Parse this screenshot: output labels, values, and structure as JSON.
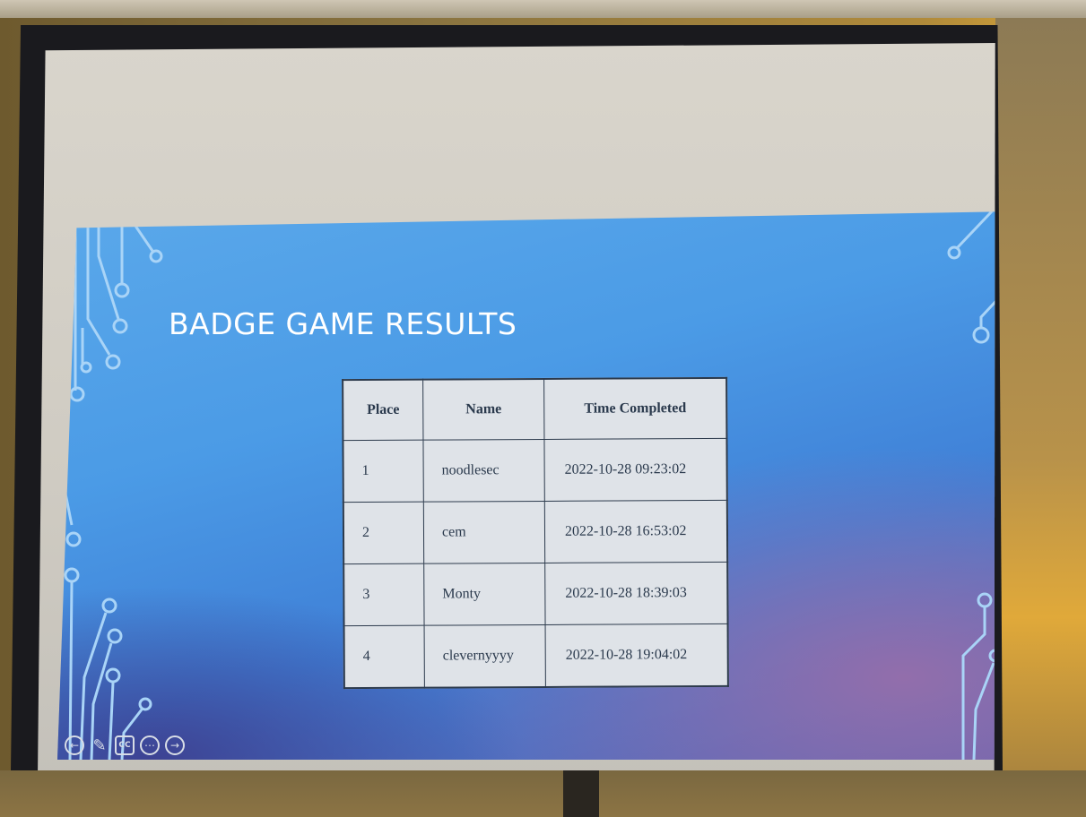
{
  "slide": {
    "title": "BADGE GAME RESULTS"
  },
  "table": {
    "headers": [
      "Place",
      "Name",
      "Time Completed"
    ],
    "rows": [
      {
        "place": "1",
        "name": "noodlesec",
        "time": "2022-10-28 09:23:02"
      },
      {
        "place": "2",
        "name": "cem",
        "time": "2022-10-28 16:53:02"
      },
      {
        "place": "3",
        "name": "Monty",
        "time": "2022-10-28 18:39:03"
      },
      {
        "place": "4",
        "name": "clevernyyyy",
        "time": "2022-10-28 19:04:02"
      }
    ]
  },
  "controls": {
    "icons": [
      "previous-icon",
      "pen-icon",
      "captions-icon",
      "more-icon",
      "next-icon"
    ],
    "captions_label": "CC"
  },
  "colors": {
    "slide_gradient_top": "#5aa8ea",
    "slide_gradient_bottom": "#5c62b0",
    "circuit_line": "#a9d4f7",
    "table_bg": "#dfe3e8"
  }
}
